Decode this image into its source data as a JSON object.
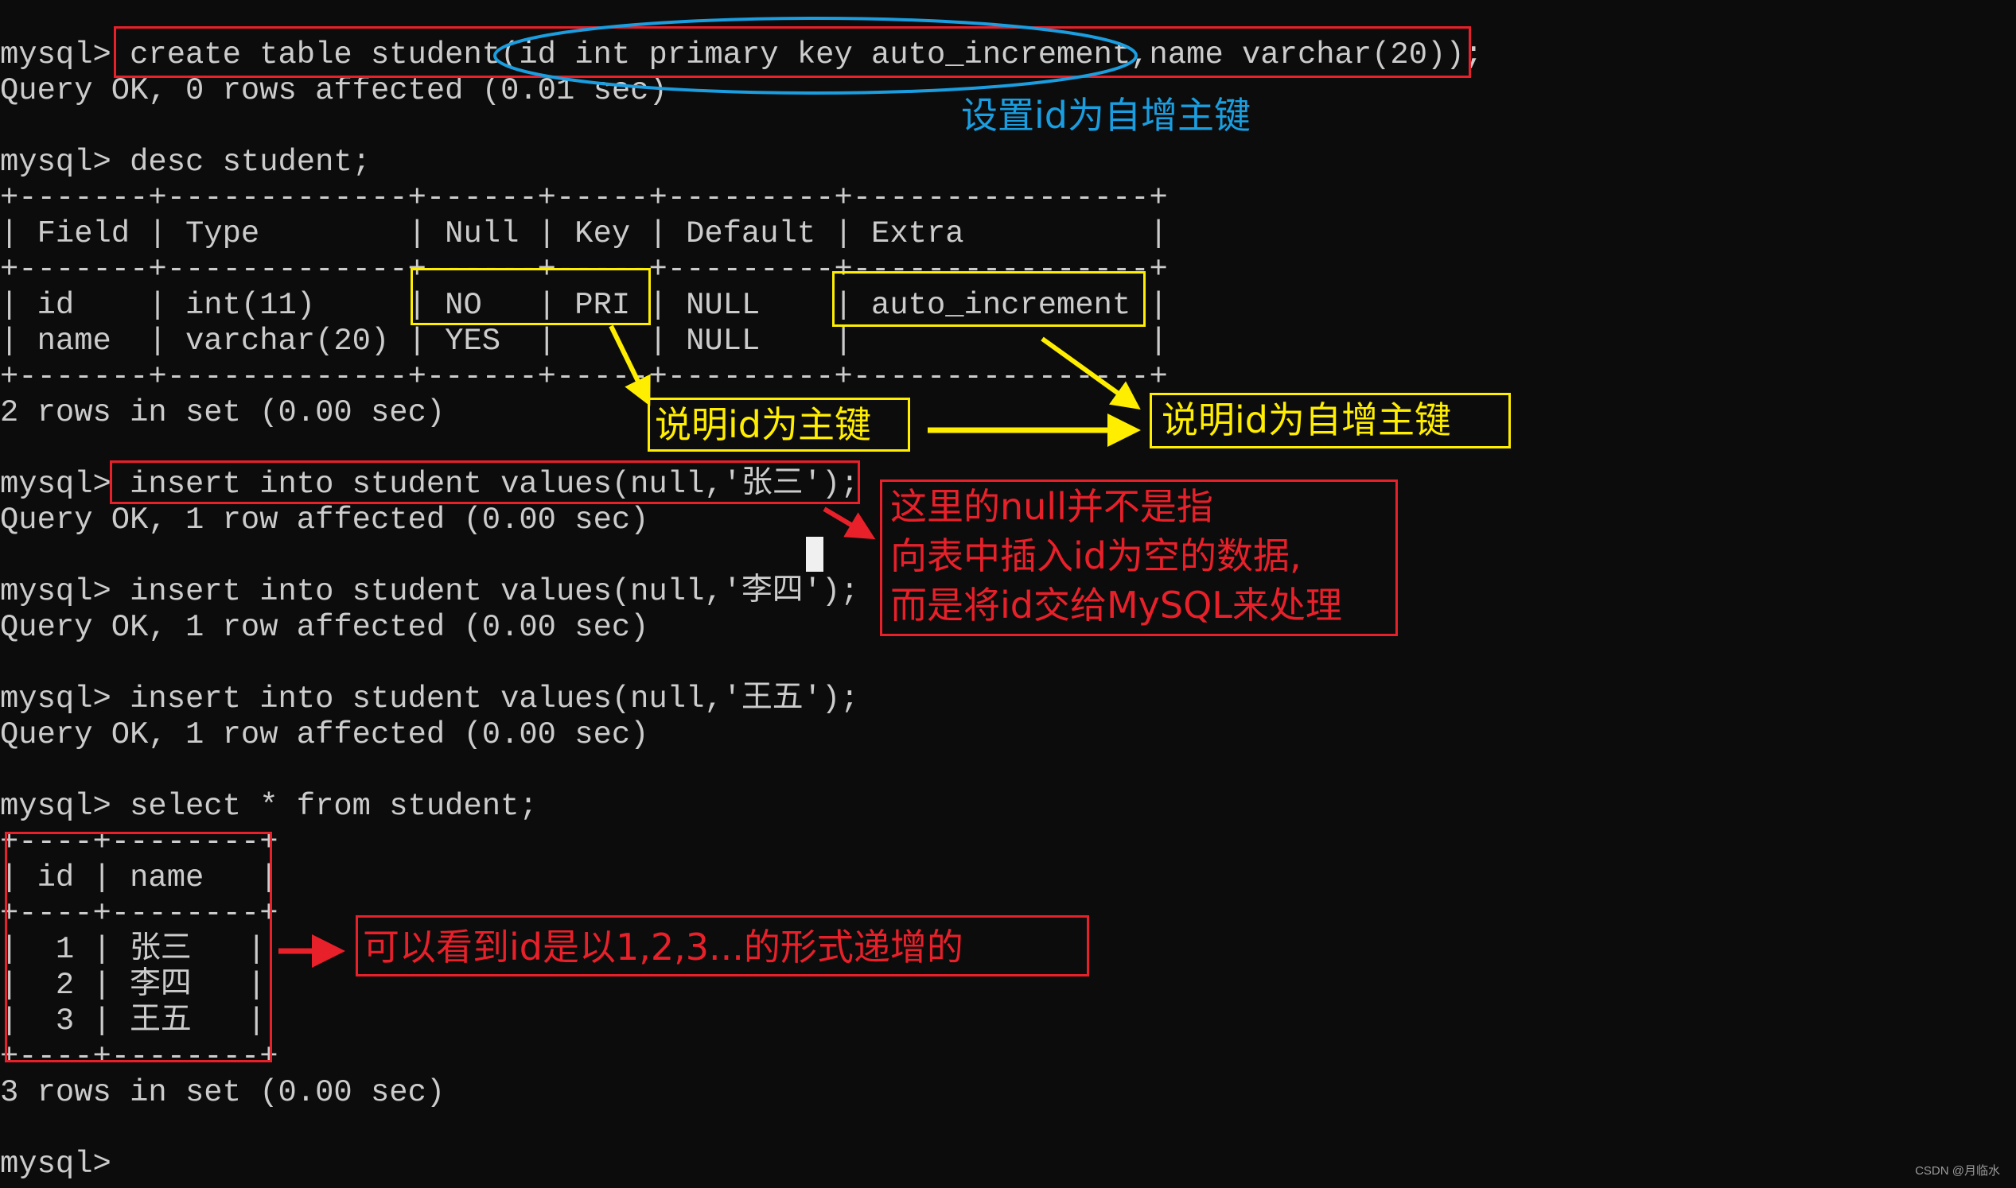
{
  "terminal": {
    "prompt": "mysql>",
    "lines": [
      "mysql> create table student(id int primary key auto_increment,name varchar(20));",
      "Query OK, 0 rows affected (0.01 sec)",
      "",
      "mysql> desc student;",
      "+-------+-------------+------+-----+---------+----------------+",
      "| Field | Type        | Null | Key | Default | Extra          |",
      "+-------+-------------+------+-----+---------+----------------+",
      "| id    | int(11)     | NO   | PRI | NULL    | auto_increment |",
      "| name  | varchar(20) | YES  |     | NULL    |                |",
      "+-------+-------------+------+-----+---------+----------------+",
      "2 rows in set (0.00 sec)",
      "",
      "mysql> insert into student values(null,'张三');",
      "Query OK, 1 row affected (0.00 sec)",
      "",
      "mysql> insert into student values(null,'李四');",
      "Query OK, 1 row affected (0.00 sec)",
      "",
      "mysql> insert into student values(null,'王五');",
      "Query OK, 1 row affected (0.00 sec)",
      "",
      "mysql> select * from student;",
      "+----+--------+",
      "| id | name   |",
      "+----+--------+",
      "|  1 | 张三   |",
      "|  2 | 李四   |",
      "|  3 | 王五   |",
      "+----+--------+",
      "3 rows in set (0.00 sec)",
      "",
      "mysql>"
    ]
  },
  "desc_table": {
    "columns": [
      "Field",
      "Type",
      "Null",
      "Key",
      "Default",
      "Extra"
    ],
    "rows": [
      [
        "id",
        "int(11)",
        "NO",
        "PRI",
        "NULL",
        "auto_increment"
      ],
      [
        "name",
        "varchar(20)",
        "YES",
        "",
        "NULL",
        ""
      ]
    ],
    "summary": "2 rows in set (0.00 sec)"
  },
  "select_table": {
    "columns": [
      "id",
      "name"
    ],
    "rows": [
      [
        "1",
        "张三"
      ],
      [
        "2",
        "李四"
      ],
      [
        "3",
        "王五"
      ]
    ],
    "summary": "3 rows in set (0.00 sec)"
  },
  "annotations": {
    "auto_increment_note": "设置id为自增主键",
    "primary_key_note": "说明id为主键",
    "auto_pk_note": "说明id为自增主键",
    "null_note": [
      "这里的null并不是指",
      "向表中插入id为空的数据,",
      "而是将id交给MySQL来处理"
    ],
    "increment_note": "可以看到id是以1,2,3...的形式递增的"
  },
  "colors": {
    "background": "#0c0c0c",
    "terminal_text": "#cccccc",
    "red": "#e8202a",
    "yellow": "#ffee00",
    "blue": "#1a9ee0"
  },
  "watermark": "CSDN @月临水"
}
